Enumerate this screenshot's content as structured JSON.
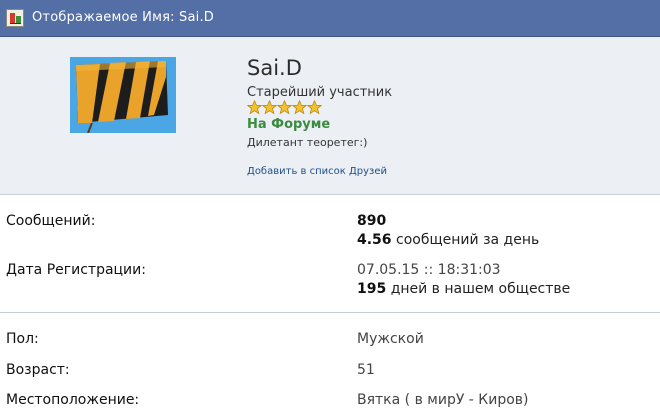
{
  "header": {
    "title": "Отображаемое Имя: Sai.D",
    "icon": "profile-card-icon"
  },
  "profile": {
    "username": "Sai.D",
    "rank": "Старейший участник",
    "stars": 5,
    "status": "На Форуме",
    "tagline": "Дилетант теоретег:)",
    "add_friend": "Добавить в список Друзей",
    "colors": {
      "background": "#ecf0f5",
      "status": "#3c8a3f",
      "link": "#1f4f8a"
    }
  },
  "stats": {
    "posts_label": "Сообщений:",
    "posts_value": "890",
    "posts_per_day_value": "4.56",
    "posts_per_day_text": "сообщений за день",
    "reg_label": "Дата Регистрации:",
    "reg_value": "07.05.15 :: 18:31:03",
    "days_value": "195",
    "days_text": "дней в нашем обществе"
  },
  "details": {
    "gender_label": "Пол:",
    "gender_value": "Мужской",
    "age_label": "Возраст:",
    "age_value": "51",
    "location_label": "Местоположение:",
    "location_value": "Вятка ( в мирУ - Киров)"
  }
}
